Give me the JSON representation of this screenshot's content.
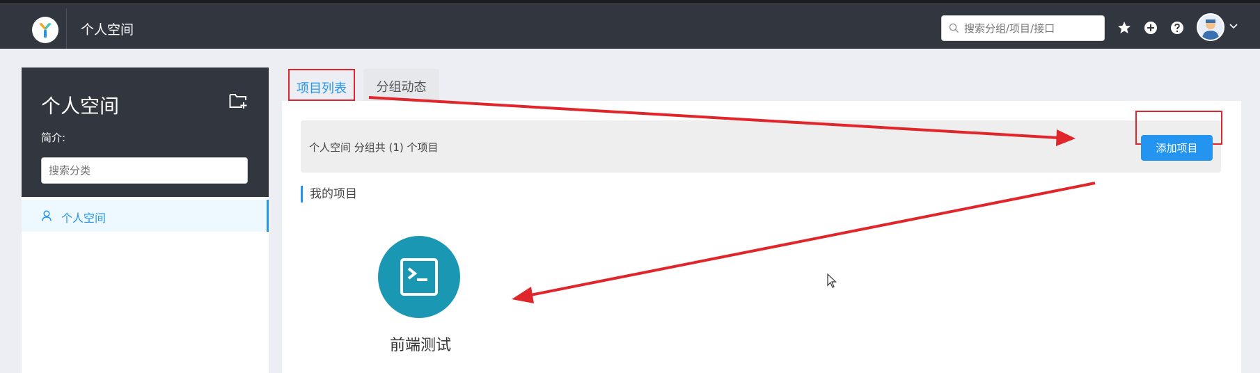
{
  "header": {
    "title": "个人空间",
    "search_placeholder": "搜索分组/项目/接口",
    "icons": [
      "star-icon",
      "add-circle-icon",
      "help-icon",
      "avatar",
      "caret-down-icon"
    ]
  },
  "sidebar": {
    "title": "个人空间",
    "description_label": "简介:",
    "search_placeholder": "搜索分类",
    "items": [
      {
        "label": "个人空间",
        "icon": "user-icon",
        "active": true
      }
    ]
  },
  "tabs": [
    {
      "label": "项目列表",
      "active": true
    },
    {
      "label": "分组动态",
      "active": false
    }
  ],
  "main": {
    "summary": "个人空间 分组共 (1) 个项目",
    "add_button": "添加项目",
    "section_title": "我的项目",
    "projects": [
      {
        "name": "前端测试",
        "icon": "terminal-icon",
        "color": "#1a97b3"
      }
    ]
  },
  "colors": {
    "header_bg": "#32363f",
    "accent": "#2395f1",
    "annotation_red": "#e0262a",
    "project_teal": "#1a97b3"
  }
}
